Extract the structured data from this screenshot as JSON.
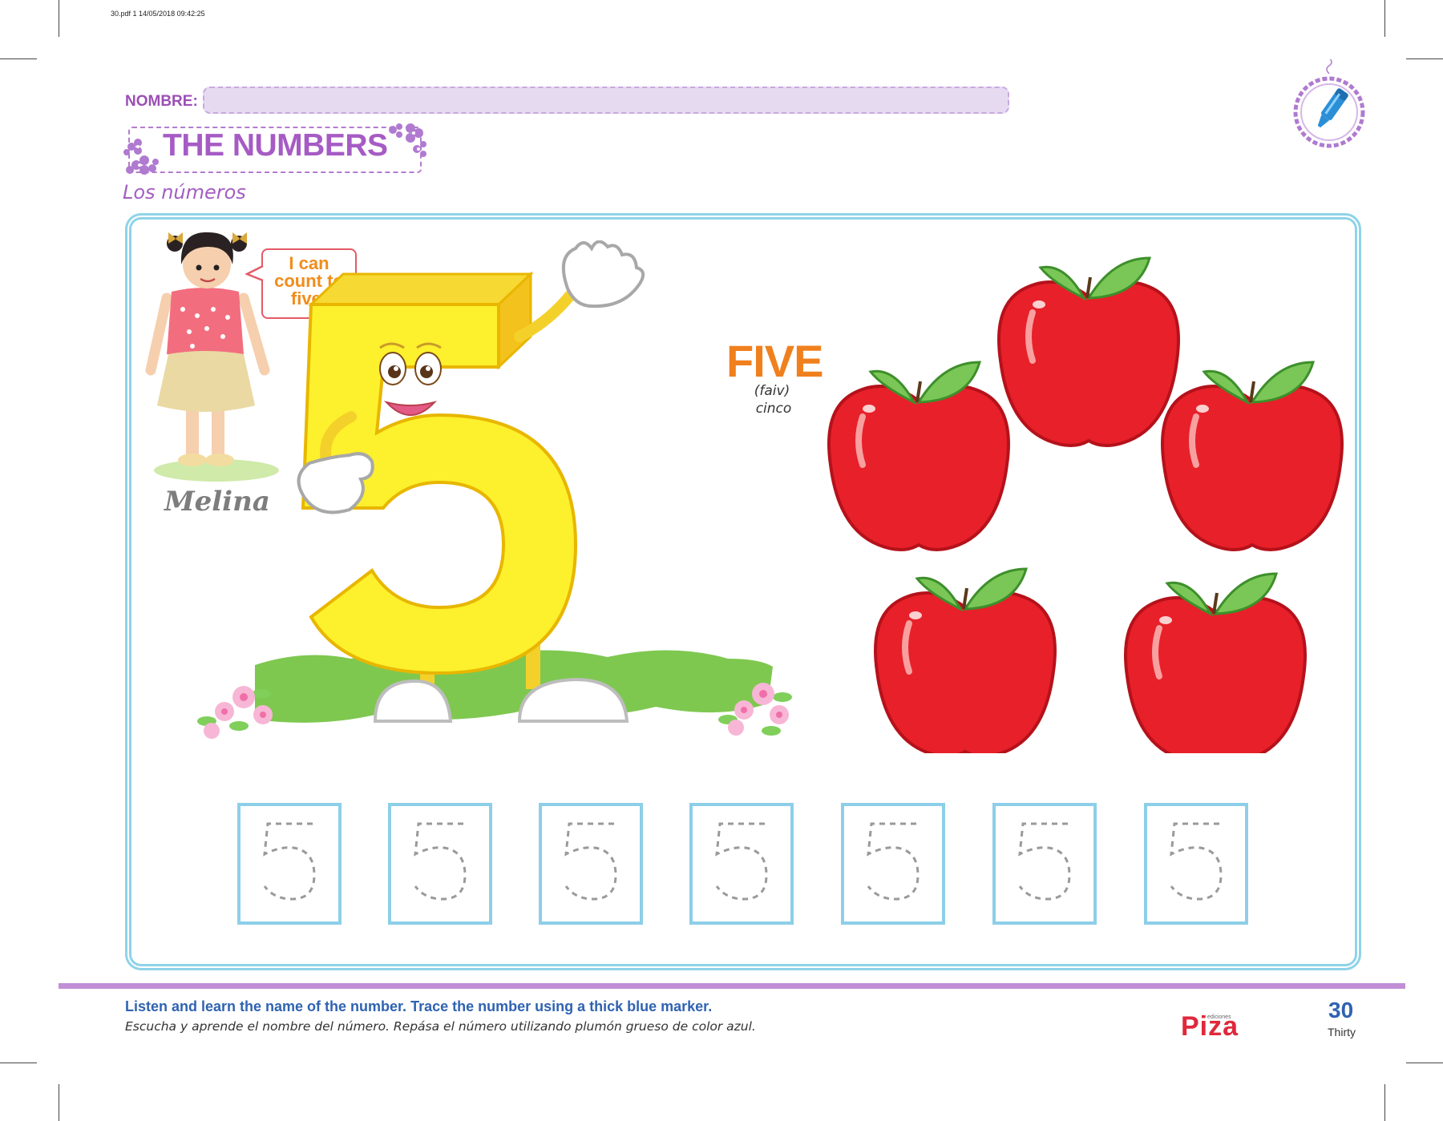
{
  "print_meta": "30.pdf   1   14/05/2018   09:42:25",
  "header": {
    "name_label": "NOMBRE:",
    "name_value": "",
    "title": "THE NUMBERS",
    "subtitle": "Los números",
    "icon": "blue-marker-badge-icon"
  },
  "character": {
    "speech_lines": [
      "I can",
      "count to",
      "five!"
    ],
    "name": "Melina"
  },
  "number": {
    "word": "FIVE",
    "pronunciation": "(faiv)",
    "spanish": "cinco",
    "apple_count": 5
  },
  "tracing": {
    "digits": [
      "5",
      "5",
      "5",
      "5",
      "5",
      "5",
      "5"
    ]
  },
  "footer": {
    "instruction_en": "Listen and learn the name of the number. Trace the number using a thick blue marker.",
    "instruction_es": "Escucha y aprende el nombre del número. Repása el número utilizando plumón grueso de color azul.",
    "brand_small": "ediciones",
    "brand": "Piza",
    "page_number": "30",
    "page_word": "Thirty"
  },
  "colors": {
    "title_purple": "#a65bc4",
    "panel_border": "#8fd3e8",
    "number_yellow": "#fdf02c",
    "apple_red": "#e8202a",
    "five_orange": "#f0801e",
    "instruction_blue": "#2f63b1",
    "brand_red": "#e0283a"
  }
}
